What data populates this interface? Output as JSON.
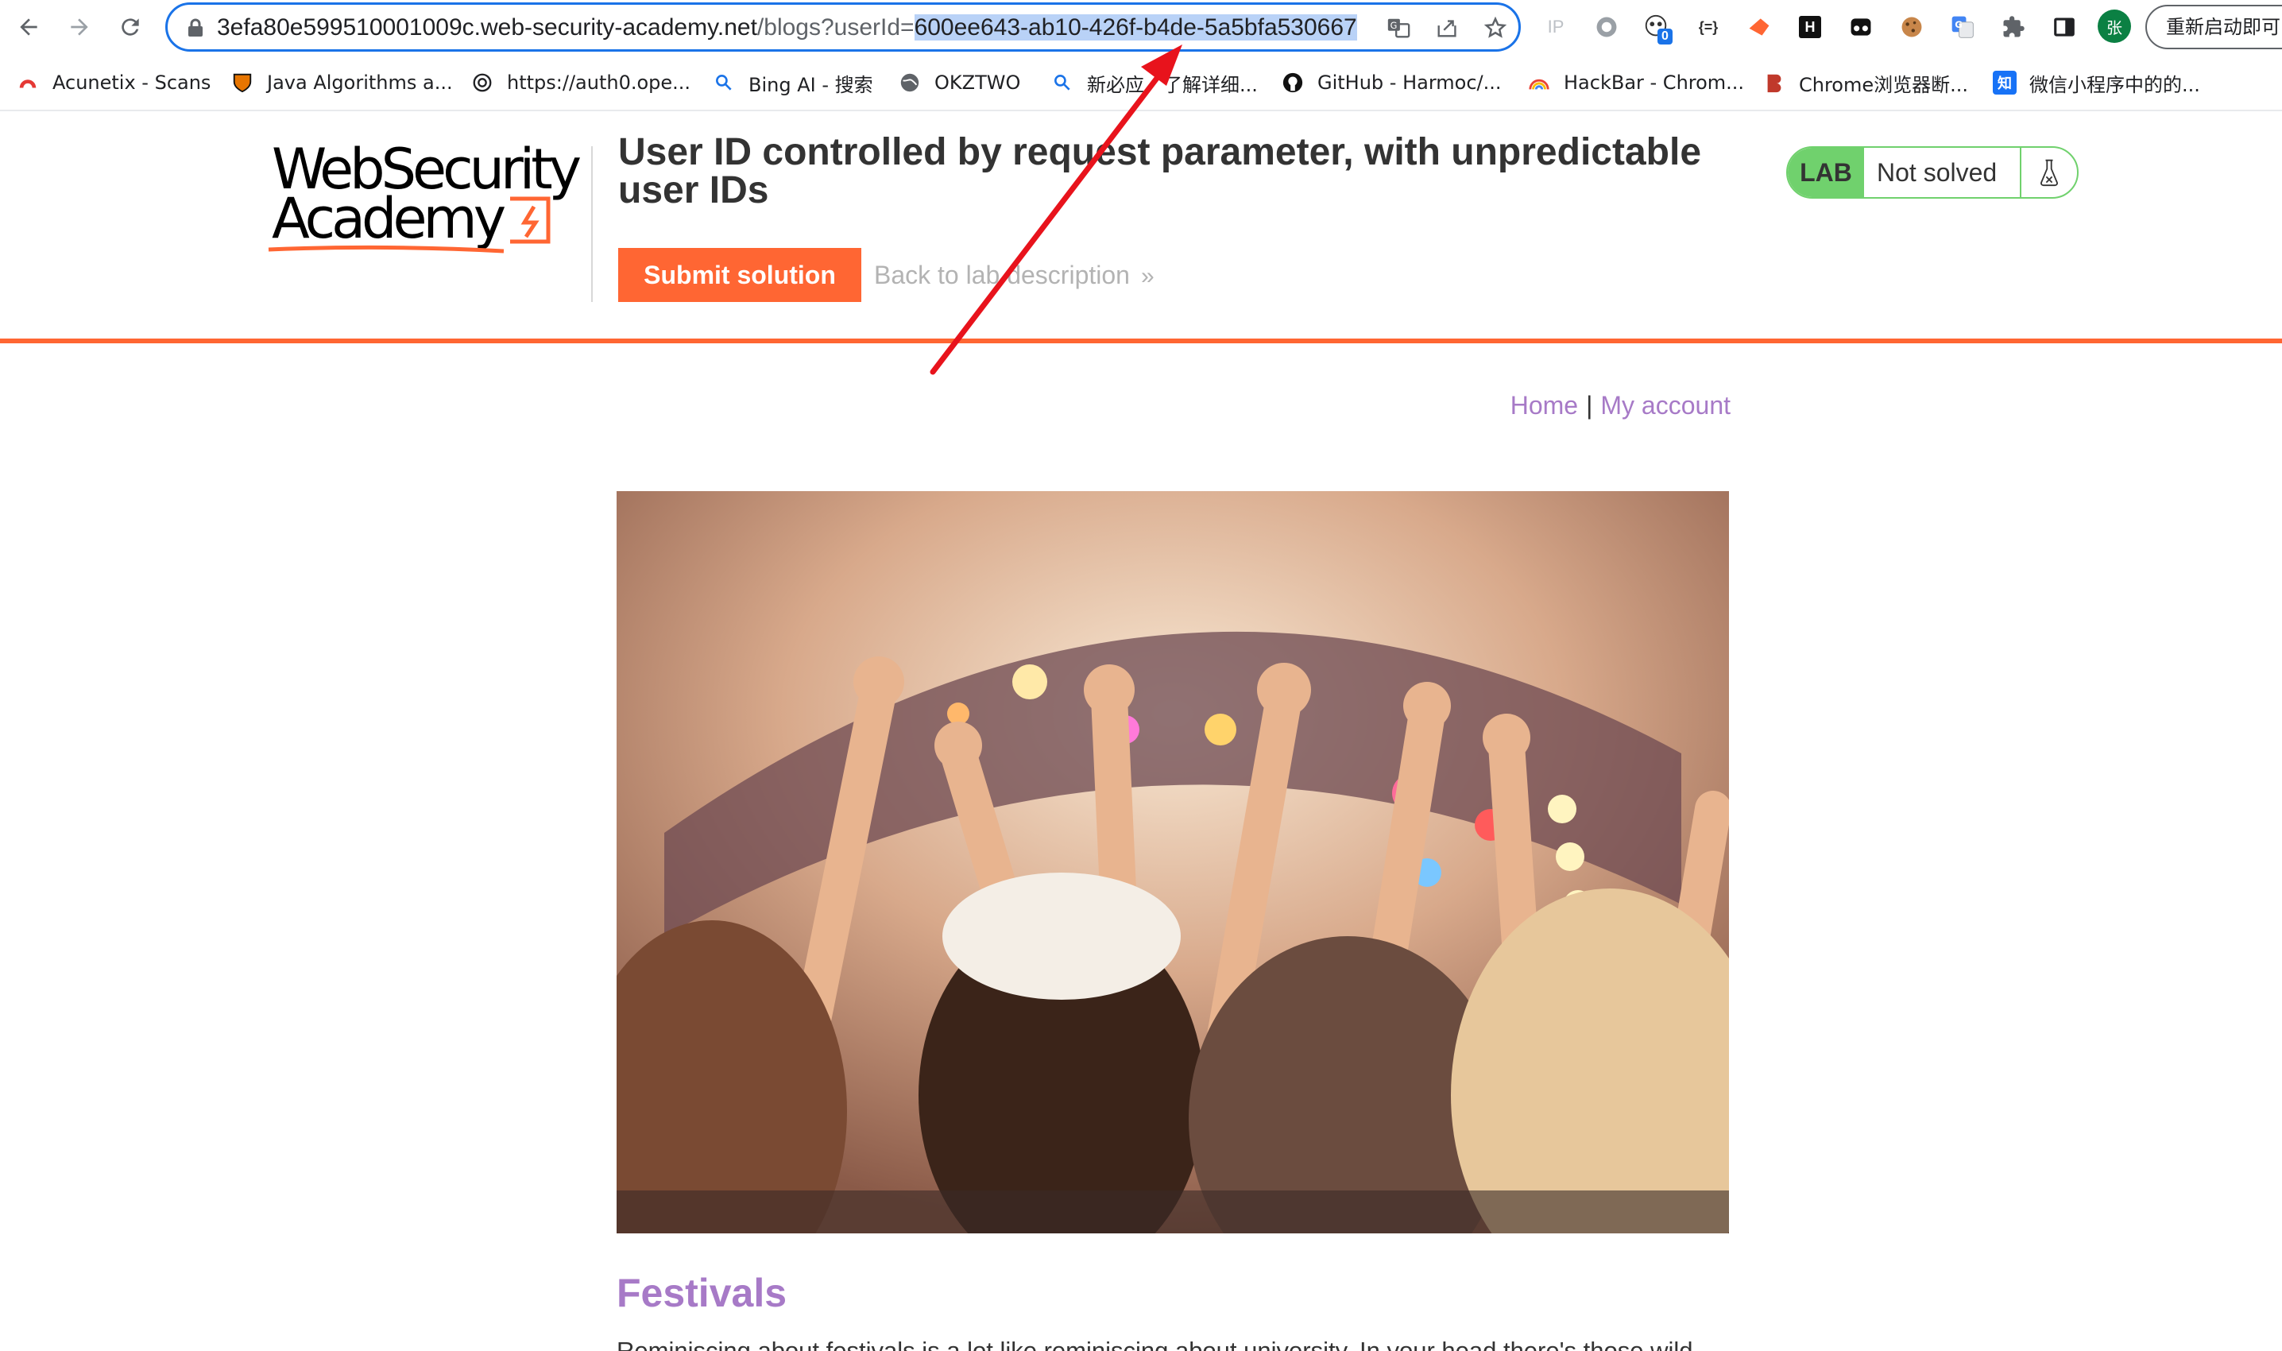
{
  "browser": {
    "url_prefix": "3efa80e599510001009c.web-security-academy.net",
    "url_path": "/blogs?userId=",
    "url_selected": "600ee643-ab10-426f-b4de-5a5bfa530667",
    "relaunch_label": "重新启动即可",
    "profile_initial": "张",
    "extension_badge": "0",
    "ip_label": "IP",
    "json_ext_label": "{=}",
    "hackbar_ext_label": "H"
  },
  "bookmarks": [
    {
      "label": "Acunetix - Scans"
    },
    {
      "label": "Java Algorithms a..."
    },
    {
      "label": "https://auth0.ope..."
    },
    {
      "label": "Bing AI - 搜索"
    },
    {
      "label": "OKZTWO"
    },
    {
      "label": "新必应，了解详细..."
    },
    {
      "label": "GitHub - Harmoc/..."
    },
    {
      "label": "HackBar - Chrom..."
    },
    {
      "label": "Chrome浏览器断..."
    },
    {
      "label": "微信小程序中的的..."
    }
  ],
  "bookmark_icons": {
    "zhihu": "知"
  },
  "lab": {
    "logo_line1": "WebSecurity",
    "logo_line2": "Academy",
    "title": "User ID controlled by request parameter, with unpredictable user IDs",
    "submit_label": "Submit solution",
    "back_label": "Back to lab description",
    "back_chevron": "»",
    "badge": "LAB",
    "status": "Not solved",
    "accent_color": "#ff6633",
    "status_color": "#70d16d"
  },
  "nav": {
    "home": "Home",
    "separator": "|",
    "my_account": "My account",
    "link_color": "#a77ac7"
  },
  "post": {
    "title": "Festivals",
    "snippet": "Reminiscing about festivals is a lot like reminiscing about university. In your head there's those wild"
  }
}
